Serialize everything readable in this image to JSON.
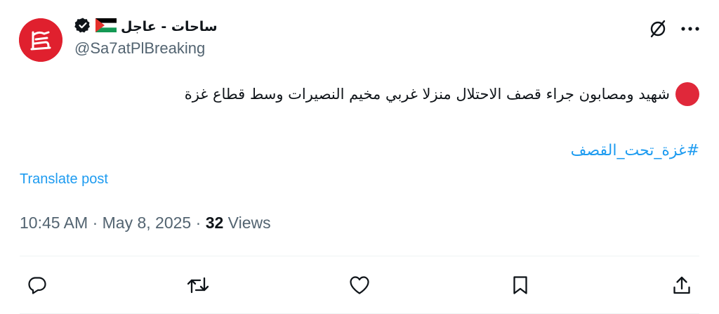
{
  "author": {
    "name": "ساحات - عاجل",
    "handle": "@Sa7atPlBreaking",
    "verified_icon": "verified-badge-icon",
    "flag_icon": "palestine-flag-icon",
    "brand_color": "#e0202e"
  },
  "header_actions": {
    "grok_icon": "slash-circle-icon",
    "more_icon": "more-dots-icon"
  },
  "tweet": {
    "text": "شهيد ومصابون جراء قصف الاحتلال منزلا غربي مخيم النصيرات وسط قطاع غزة",
    "hashtag": "#غزة_تحت_القصف",
    "translate_label": "Translate post",
    "time": "10:45 AM",
    "date": "May 8, 2025",
    "separator": "·",
    "views_count": "32",
    "views_label": "Views"
  },
  "actions": [
    {
      "icon": "reply-icon"
    },
    {
      "icon": "retweet-icon"
    },
    {
      "icon": "like-icon"
    },
    {
      "icon": "bookmark-icon"
    },
    {
      "icon": "share-icon"
    }
  ],
  "colors": {
    "link": "#1d9bf0",
    "secondary_text": "#536471",
    "red_dot": "#e0283a"
  }
}
